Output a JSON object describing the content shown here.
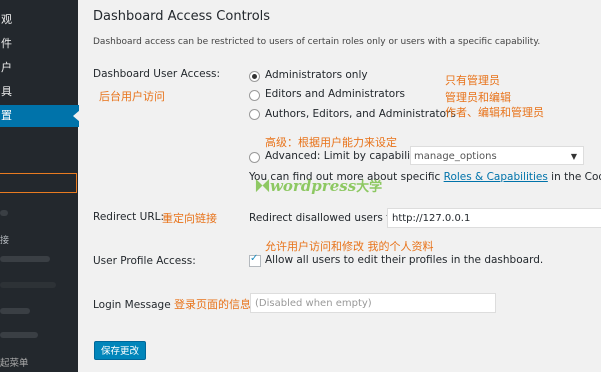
{
  "sidebar": {
    "items": [
      {
        "label": "观"
      },
      {
        "label": "件"
      },
      {
        "label": "户"
      },
      {
        "label": "具"
      },
      {
        "label": "置"
      }
    ],
    "sub_items": [
      {
        "label": "接"
      },
      {
        "label": "起菜单"
      }
    ]
  },
  "page": {
    "heading": "Dashboard Access Controls",
    "description": "Dashboard access can be restricted to users of certain roles only or users with a specific capability."
  },
  "access": {
    "label": "Dashboard User Access:",
    "label_note": "后台用户访问",
    "options": [
      {
        "label": "Administrators only",
        "selected": true
      },
      {
        "label": "Editors and Administrators",
        "selected": false
      },
      {
        "label": "Authors, Editors, and Administrators",
        "selected": false
      },
      {
        "label": "Advanced: Limit by capability:",
        "selected": false
      }
    ],
    "notes": [
      "只有管理员",
      "管理员和编辑",
      "作者、编辑和管理员"
    ],
    "advanced_note": "高级：根据用户能力来设定",
    "capability_value": "manage_options",
    "help_prefix": "You can find out more about specific ",
    "help_link": "Roles & Capabilities",
    "help_suffix": " in the Codex."
  },
  "watermark": {
    "text": "wordpress",
    "cn": "大学"
  },
  "redirect": {
    "label": "Redirect URL:",
    "label_note": "重定向链接",
    "field_label": "Redirect disallowed users to:",
    "value": "http://127.0.0.1"
  },
  "profile": {
    "label": "User Profile Access:",
    "note": "允许用户访问和修改 我的个人资料",
    "checkbox_label": "Allow all users to edit their profiles in the dashboard.",
    "checked": true
  },
  "login": {
    "label": "Login Message",
    "label_note": "登录页面的信息",
    "placeholder": "(Disabled when empty)"
  },
  "save_button": "保存更改",
  "colors": {
    "accent": "#0073aa",
    "annotation": "#e8731a",
    "sidebar": "#23282d"
  }
}
